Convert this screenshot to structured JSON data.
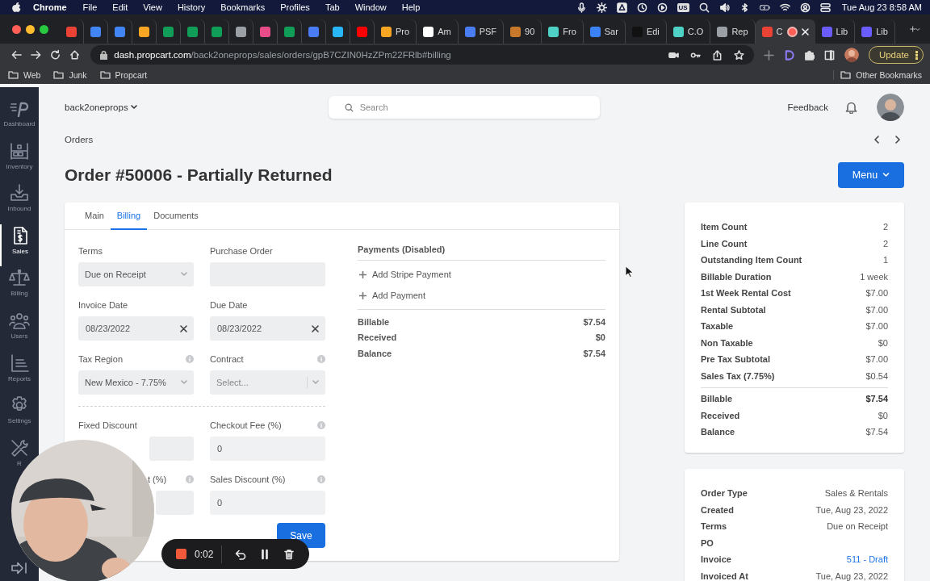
{
  "menubar": {
    "app": "Chrome",
    "items": [
      "File",
      "Edit",
      "View",
      "History",
      "Bookmarks",
      "Profiles",
      "Tab",
      "Window",
      "Help"
    ],
    "keyboard": "US",
    "clock": "Tue Aug 23  8:58 AM"
  },
  "browser": {
    "tabs": [
      {
        "color": "#ea4335",
        "selected": false
      },
      {
        "color": "#4285f4",
        "selected": false
      },
      {
        "color": "#4285f4",
        "selected": false
      },
      {
        "color": "#f6a623",
        "selected": false
      },
      {
        "color": "#0f9d58",
        "selected": false
      },
      {
        "color": "#0f9d58",
        "selected": false
      },
      {
        "color": "#0f9d58",
        "selected": false
      },
      {
        "color": "#9aa0a6",
        "selected": false
      },
      {
        "color": "#ea4c89",
        "selected": false
      },
      {
        "color": "#0f9d58",
        "selected": false
      },
      {
        "color": "#4a7cf3",
        "selected": false
      },
      {
        "color": "#29b6f6",
        "selected": false
      },
      {
        "color": "#ff0000",
        "selected": false
      },
      {
        "label": "Pro",
        "color": "#f6a623",
        "selected": false
      },
      {
        "label": "Am",
        "color": "#ffffff",
        "selected": false
      },
      {
        "label": "PSF",
        "color": "#4a7cf3",
        "selected": false
      },
      {
        "label": "90",
        "color": "#c8782a",
        "selected": false
      },
      {
        "label": "Fro",
        "color": "#4fd1c5",
        "selected": false
      },
      {
        "label": "Sar",
        "color": "#3b82f6",
        "selected": false
      },
      {
        "label": "Edi",
        "color": "#111111",
        "selected": false
      },
      {
        "label": "C.O",
        "color": "#4fd1c5",
        "selected": false
      },
      {
        "label": "Rep",
        "color": "#9aa0a6",
        "selected": false
      },
      {
        "label": "C",
        "color": "#ea4335",
        "selected": true
      },
      {
        "label": "Lib",
        "color": "#6a5cff",
        "selected": false
      },
      {
        "label": "Lib",
        "color": "#6a5cff",
        "selected": false
      }
    ],
    "url_host": "dash.propcart.com",
    "url_path": "/back2oneprops/sales/orders/gpB7CZIN0HzZPm22FRlb#billing",
    "update_button": "Update",
    "bookmarks": [
      "Web",
      "Junk",
      "Propcart"
    ],
    "other_bookmarks": "Other Bookmarks"
  },
  "sidebar": {
    "items": [
      {
        "label": "Dashboard",
        "kind": "logo",
        "selected": false
      },
      {
        "label": "Inventory",
        "kind": "inventory",
        "selected": false
      },
      {
        "label": "Inbound",
        "kind": "inbound",
        "selected": false
      },
      {
        "label": "Sales",
        "kind": "sales",
        "selected": true
      },
      {
        "label": "Billing",
        "kind": "billing",
        "selected": false
      },
      {
        "label": "Users",
        "kind": "users",
        "selected": false
      },
      {
        "label": "Reports",
        "kind": "reports",
        "selected": false
      },
      {
        "label": "Settings",
        "kind": "settings",
        "selected": false
      },
      {
        "label": "R",
        "kind": "tools",
        "selected": false
      }
    ]
  },
  "header": {
    "org": "back2oneprops",
    "search_placeholder": "Search",
    "feedback": "Feedback"
  },
  "breadcrumb": "Orders",
  "title": "Order #50006 - Partially Returned",
  "menu_button": "Menu",
  "tabs": [
    {
      "label": "Main",
      "selected": false
    },
    {
      "label": "Billing",
      "selected": true
    },
    {
      "label": "Documents",
      "selected": false
    }
  ],
  "form": {
    "rows": [
      [
        {
          "label": "Terms",
          "kind": "select",
          "value": "Due on Receipt",
          "info": false
        },
        {
          "label": "Purchase Order",
          "kind": "input",
          "info": false
        }
      ],
      [
        {
          "label": "Invoice Date",
          "kind": "date",
          "value": "08/23/2022",
          "info": false
        },
        {
          "label": "Due Date",
          "kind": "date",
          "value": "08/23/2022",
          "info": false
        }
      ],
      [
        {
          "label": "Tax Region",
          "kind": "select",
          "value": "New Mexico - 7.75%",
          "info": true
        },
        {
          "label": "Contract",
          "kind": "select",
          "placeholder": "Select...",
          "info": true
        }
      ],
      [
        {
          "label": "Fixed Discount",
          "kind": "input",
          "info": false
        },
        {
          "label": "Checkout Fee (%)",
          "kind": "input",
          "value": "0",
          "info": true
        }
      ],
      [
        {
          "label": "t (%)",
          "kind": "input",
          "info": true
        },
        {
          "label": "Sales Discount (%)",
          "kind": "input",
          "value": "0",
          "info": true
        }
      ]
    ],
    "save_button": "Save"
  },
  "payments": {
    "title": "Payments (Disabled)",
    "actions": [
      "Add Stripe Payment",
      "Add Payment"
    ],
    "totals": [
      {
        "label": "Billable",
        "value": "$7.54"
      },
      {
        "label": "Received",
        "value": "$0"
      },
      {
        "label": "Balance",
        "value": "$7.54"
      }
    ]
  },
  "summary": {
    "rows": [
      {
        "label": "Item Count",
        "value": "2"
      },
      {
        "label": "Line Count",
        "value": "2"
      },
      {
        "label": "Outstanding Item Count",
        "value": "1"
      },
      {
        "label": "Billable Duration",
        "value": "1 week"
      },
      {
        "label": "1st Week Rental Cost",
        "value": "$7.00"
      },
      {
        "label": "Rental Subtotal",
        "value": "$7.00"
      },
      {
        "label": "Taxable",
        "value": "$7.00"
      },
      {
        "label": "Non Taxable",
        "value": "$0"
      },
      {
        "label": "Pre Tax Subtotal",
        "value": "$7.00"
      },
      {
        "label": "Sales Tax (7.75%)",
        "value": "$0.54"
      }
    ],
    "totals": [
      {
        "label": "Billable",
        "value": "$7.54",
        "emphasized": true
      },
      {
        "label": "Received",
        "value": "$0",
        "emphasized": false
      },
      {
        "label": "Balance",
        "value": "$7.54",
        "emphasized": false
      }
    ]
  },
  "details": {
    "rows": [
      {
        "label": "Order Type",
        "value": "Sales & Rentals",
        "kind": "text"
      },
      {
        "label": "Created",
        "value": "Tue, Aug 23, 2022",
        "kind": "text"
      },
      {
        "label": "Terms",
        "value": "Due on Receipt",
        "kind": "text"
      },
      {
        "label": "PO",
        "kind": "text"
      },
      {
        "label": "Invoice",
        "value": "511 - Draft",
        "kind": "link"
      },
      {
        "label": "Invoiced At",
        "value": "Tue, Aug 23, 2022",
        "kind": "text"
      }
    ]
  },
  "recorder": {
    "time": "0:02"
  }
}
